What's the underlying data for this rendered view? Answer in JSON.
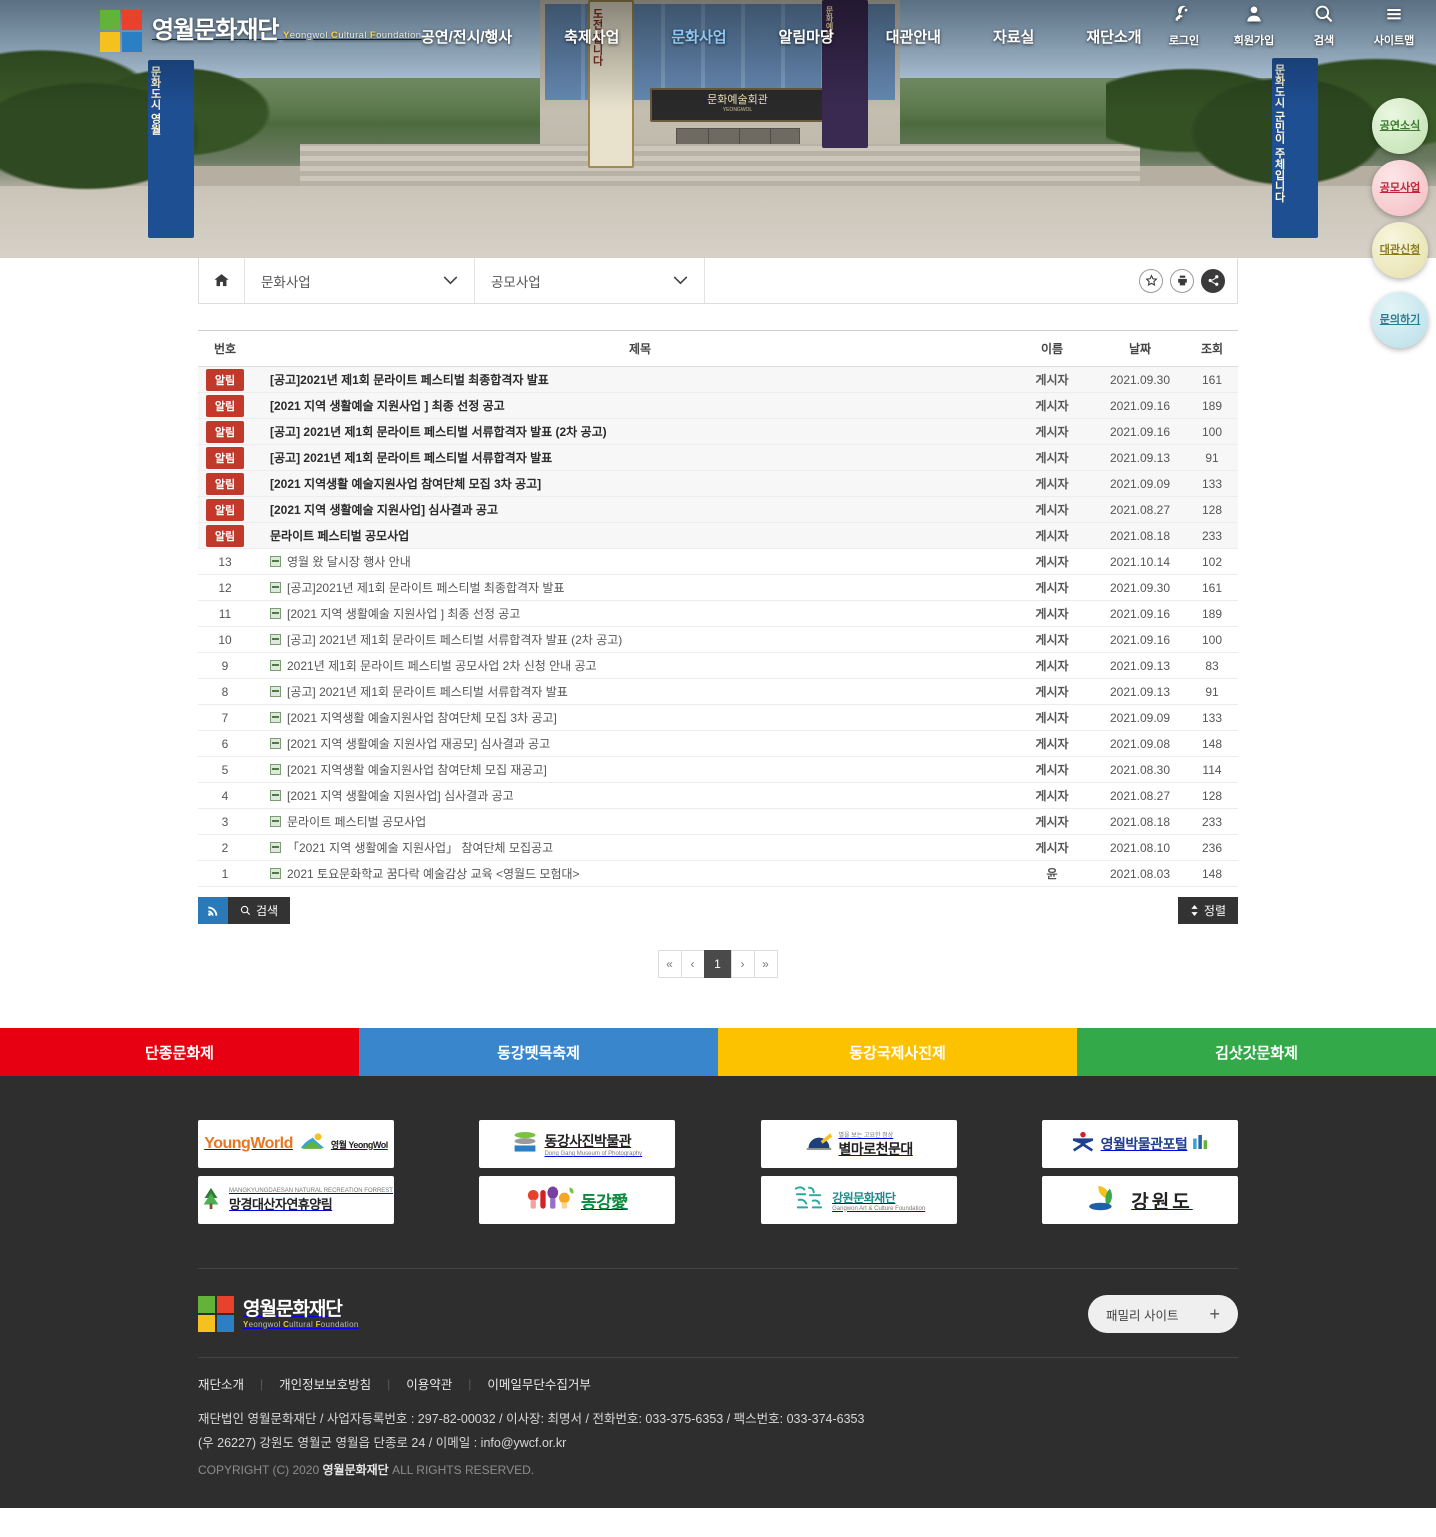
{
  "site": {
    "logo_kr": "영월문화재단",
    "logo_en_parts": [
      "Y",
      "eongwol ",
      "C",
      "ultural ",
      "F",
      "oundation"
    ],
    "logo_en": "Yeongwol Cultural Foundation"
  },
  "nav": {
    "items": [
      {
        "label": "공연/전시/행사",
        "active": false
      },
      {
        "label": "축제사업",
        "active": false
      },
      {
        "label": "문화사업",
        "active": true
      },
      {
        "label": "알림마당",
        "active": false
      },
      {
        "label": "대관안내",
        "active": false
      },
      {
        "label": "자료실",
        "active": false
      },
      {
        "label": "재단소개",
        "active": false
      }
    ]
  },
  "utils": [
    {
      "label": "로그인",
      "icon": "key-icon"
    },
    {
      "label": "회원가입",
      "icon": "person-icon"
    },
    {
      "label": "검색",
      "icon": "search-icon"
    },
    {
      "label": "사이트맵",
      "icon": "hamburger-icon"
    }
  ],
  "quick_buttons": [
    {
      "label": "공연소식",
      "color": "#bfe0ae"
    },
    {
      "label": "공모사업",
      "color": "#f3bcc1"
    },
    {
      "label": "대관신청",
      "color": "#e6e0ab"
    },
    {
      "label": "문의하기",
      "color": "#b9dfe8"
    }
  ],
  "location": {
    "home_icon": "home-icon",
    "depth1": "문화사업",
    "depth2": "공모사업",
    "actions": [
      {
        "name": "favorite",
        "icon": "star-icon"
      },
      {
        "name": "print",
        "icon": "printer-icon"
      },
      {
        "name": "share",
        "icon": "share-icon"
      }
    ]
  },
  "board": {
    "columns": {
      "no": "번호",
      "title": "제목",
      "name": "이름",
      "date": "날짜",
      "hits": "조회"
    },
    "notice_badge": "알림",
    "notices": [
      {
        "title": "[공고]2021년 제1회 문라이트 페스티벌 최종합격자 발표",
        "name": "게시자",
        "date": "2021.09.30",
        "hits": "161"
      },
      {
        "title": "[2021 지역 생활예술 지원사업 ] 최종 선정 공고",
        "name": "게시자",
        "date": "2021.09.16",
        "hits": "189"
      },
      {
        "title": "[공고] 2021년 제1회 문라이트 페스티벌 서류합격자 발표 (2차 공고)",
        "name": "게시자",
        "date": "2021.09.16",
        "hits": "100"
      },
      {
        "title": "[공고] 2021년 제1회 문라이트 페스티벌 서류합격자 발표",
        "name": "게시자",
        "date": "2021.09.13",
        "hits": "91"
      },
      {
        "title": "[2021 지역생활 예술지원사업 참여단체 모집 3차 공고]",
        "name": "게시자",
        "date": "2021.09.09",
        "hits": "133"
      },
      {
        "title": "[2021 지역 생활예술 지원사업] 심사결과 공고",
        "name": "게시자",
        "date": "2021.08.27",
        "hits": "128"
      },
      {
        "title": "문라이트 페스티벌 공모사업",
        "name": "게시자",
        "date": "2021.08.18",
        "hits": "233"
      }
    ],
    "rows": [
      {
        "no": "13",
        "title": "영월 왔 달시장 행사 안내",
        "name": "게시자",
        "date": "2021.10.14",
        "hits": "102"
      },
      {
        "no": "12",
        "title": "[공고]2021년 제1회 문라이트 페스티벌 최종합격자 발표",
        "name": "게시자",
        "date": "2021.09.30",
        "hits": "161"
      },
      {
        "no": "11",
        "title": "[2021 지역 생활예술 지원사업 ] 최종 선정 공고",
        "name": "게시자",
        "date": "2021.09.16",
        "hits": "189"
      },
      {
        "no": "10",
        "title": "[공고] 2021년 제1회 문라이트 페스티벌 서류합격자 발표 (2차 공고)",
        "name": "게시자",
        "date": "2021.09.16",
        "hits": "100"
      },
      {
        "no": "9",
        "title": "2021년 제1회 문라이트 페스티벌 공모사업 2차 신청 안내 공고",
        "name": "게시자",
        "date": "2021.09.13",
        "hits": "83"
      },
      {
        "no": "8",
        "title": "[공고] 2021년 제1회 문라이트 페스티벌 서류합격자 발표",
        "name": "게시자",
        "date": "2021.09.13",
        "hits": "91"
      },
      {
        "no": "7",
        "title": "[2021 지역생활 예술지원사업 참여단체 모집 3차 공고]",
        "name": "게시자",
        "date": "2021.09.09",
        "hits": "133"
      },
      {
        "no": "6",
        "title": "[2021 지역 생활예술 지원사업 재공모] 심사결과 공고",
        "name": "게시자",
        "date": "2021.09.08",
        "hits": "148"
      },
      {
        "no": "5",
        "title": "[2021 지역생활 예술지원사업 참여단체 모집 재공고]",
        "name": "게시자",
        "date": "2021.08.30",
        "hits": "114"
      },
      {
        "no": "4",
        "title": "[2021 지역 생활예술 지원사업] 심사결과 공고",
        "name": "게시자",
        "date": "2021.08.27",
        "hits": "128"
      },
      {
        "no": "3",
        "title": "문라이트 페스티벌 공모사업",
        "name": "게시자",
        "date": "2021.08.18",
        "hits": "233"
      },
      {
        "no": "2",
        "title": "「2021 지역 생활예술 지원사업」 참여단체 모집공고",
        "name": "게시자",
        "date": "2021.08.10",
        "hits": "236"
      },
      {
        "no": "1",
        "title": "2021 토요문화학교 꿈다락 예술감상 교육 <영월드 모험대>",
        "name": "윤",
        "date": "2021.08.03",
        "hits": "148"
      }
    ],
    "rss_label": "RSS",
    "search_label": "검색",
    "sort_label": "정렬",
    "pagination": {
      "first": "«",
      "prev": "‹",
      "pages": [
        "1"
      ],
      "current": "1",
      "next": "›",
      "last": "»"
    }
  },
  "festivals": [
    {
      "label": "단종문화제",
      "color": "#e60012"
    },
    {
      "label": "동강뗏목축제",
      "color": "#3a86cd"
    },
    {
      "label": "동강국제사진제",
      "color": "#fcc200"
    },
    {
      "label": "김삿갓문화제",
      "color": "#34a94a"
    }
  ],
  "partners": [
    {
      "name": "young-world-yeongwol",
      "main": "YoungWorld",
      "sub": "영월 YeongWol"
    },
    {
      "name": "donggang-museum-of-photography",
      "main": "동강사진박물관",
      "sub": "Dong Gang Museum of Photography"
    },
    {
      "name": "byeolmaro-observatory",
      "main": "별마로천문대",
      "sub": "별을 보는 고요한 정상"
    },
    {
      "name": "yeongwol-museum-portal",
      "main": "영월박물관포털",
      "sub": ""
    },
    {
      "name": "manggyeongdaesan-recreation-forest",
      "main": "망경대산자연휴양림",
      "sub": "MANGKYUNGDAESAN NATURAL RECREATION FORREST"
    },
    {
      "name": "donggang-ae",
      "main": "동강愛",
      "sub": ""
    },
    {
      "name": "gangwon-art-culture-foundation",
      "main": "강원문화재단",
      "sub": "Gangwon Art & Culture Foundation"
    },
    {
      "name": "gangwon-do",
      "main": "강원도",
      "sub": ""
    }
  ],
  "footer": {
    "family_site": "패밀리 사이트",
    "family_plus": "+",
    "links": [
      "재단소개",
      "개인정보보호방침",
      "이용약관",
      "이메일무단수집거부"
    ],
    "address_line1": "재단법인 영월문화재단 / 사업자등록번호 : 297-82-00032 / 이사장: 최명서 / 전화번호: 033-375-6353 / 팩스번호: 033-374-6353",
    "address_line2": "(우 26227) 강원도 영월군 영월읍 단종로 24 / 이메일 : info@ywcf.or.kr",
    "copyright_pre": "COPYRIGHT (C) 2020 ",
    "copyright_brand": "영월문화재단",
    "copyright_post": " ALL RIGHTS RESERVED."
  }
}
